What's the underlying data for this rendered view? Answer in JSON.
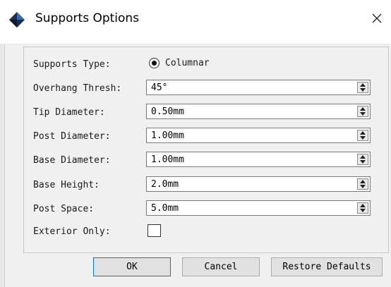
{
  "window": {
    "title": "Supports Options",
    "close_glyph": "✕"
  },
  "form": {
    "supports_type": {
      "label": "Supports Type:",
      "option": "Columnar",
      "selected": true
    },
    "fields": [
      {
        "label": "Overhang Thresh:",
        "value": "45°"
      },
      {
        "label": "Tip Diameter:",
        "value": "0.50mm"
      },
      {
        "label": "Post Diameter:",
        "value": "1.00mm"
      },
      {
        "label": "Base Diameter:",
        "value": "1.00mm"
      },
      {
        "label": "Base Height:",
        "value": "2.0mm"
      },
      {
        "label": "Post Space:",
        "value": "5.0mm"
      }
    ],
    "exterior_only": {
      "label": "Exterior Only:",
      "checked": false
    }
  },
  "buttons": {
    "ok": "OK",
    "cancel": "Cancel",
    "restore": "Restore Defaults"
  }
}
